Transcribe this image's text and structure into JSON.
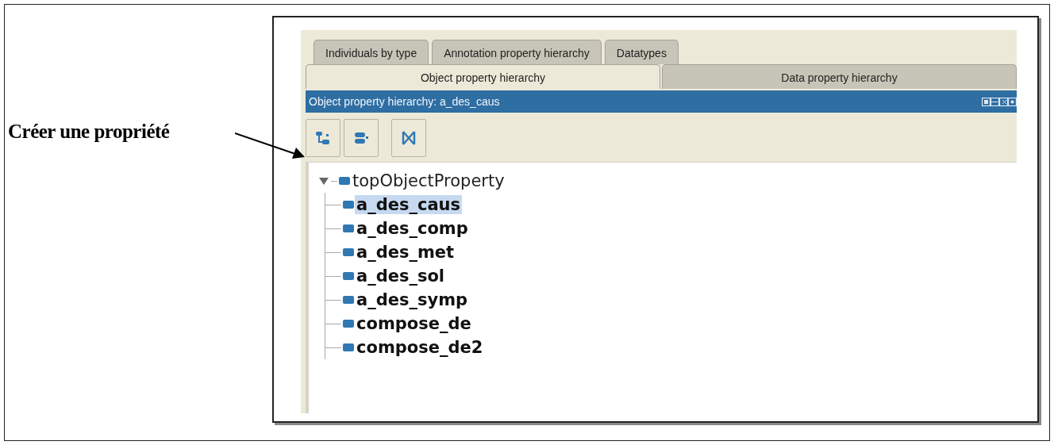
{
  "annotation": {
    "text": "Créer une propriété"
  },
  "tab_rows": [
    [
      {
        "label": "Individuals by type",
        "selected": false
      },
      {
        "label": "Annotation property hierarchy",
        "selected": false
      },
      {
        "label": "Datatypes",
        "selected": false
      }
    ],
    [
      {
        "label": "Object property hierarchy",
        "selected": true
      },
      {
        "label": "Data property hierarchy",
        "selected": false
      }
    ]
  ],
  "view": {
    "title": "Object property hierarchy: a_des_caus"
  },
  "toolbar": [
    {
      "kind": "add-sub"
    },
    {
      "kind": "add-sibling"
    },
    {
      "kind": "delete"
    }
  ],
  "tree": {
    "label": "topObjectProperty",
    "expanded": true,
    "selected": false,
    "children": [
      {
        "label": "a_des_caus",
        "selected": true
      },
      {
        "label": "a_des_comp",
        "selected": false
      },
      {
        "label": "a_des_met",
        "selected": false
      },
      {
        "label": "a_des_sol",
        "selected": false
      },
      {
        "label": "a_des_symp",
        "selected": false
      },
      {
        "label": "compose_de",
        "selected": false
      },
      {
        "label": "compose_de2",
        "selected": false
      }
    ]
  }
}
